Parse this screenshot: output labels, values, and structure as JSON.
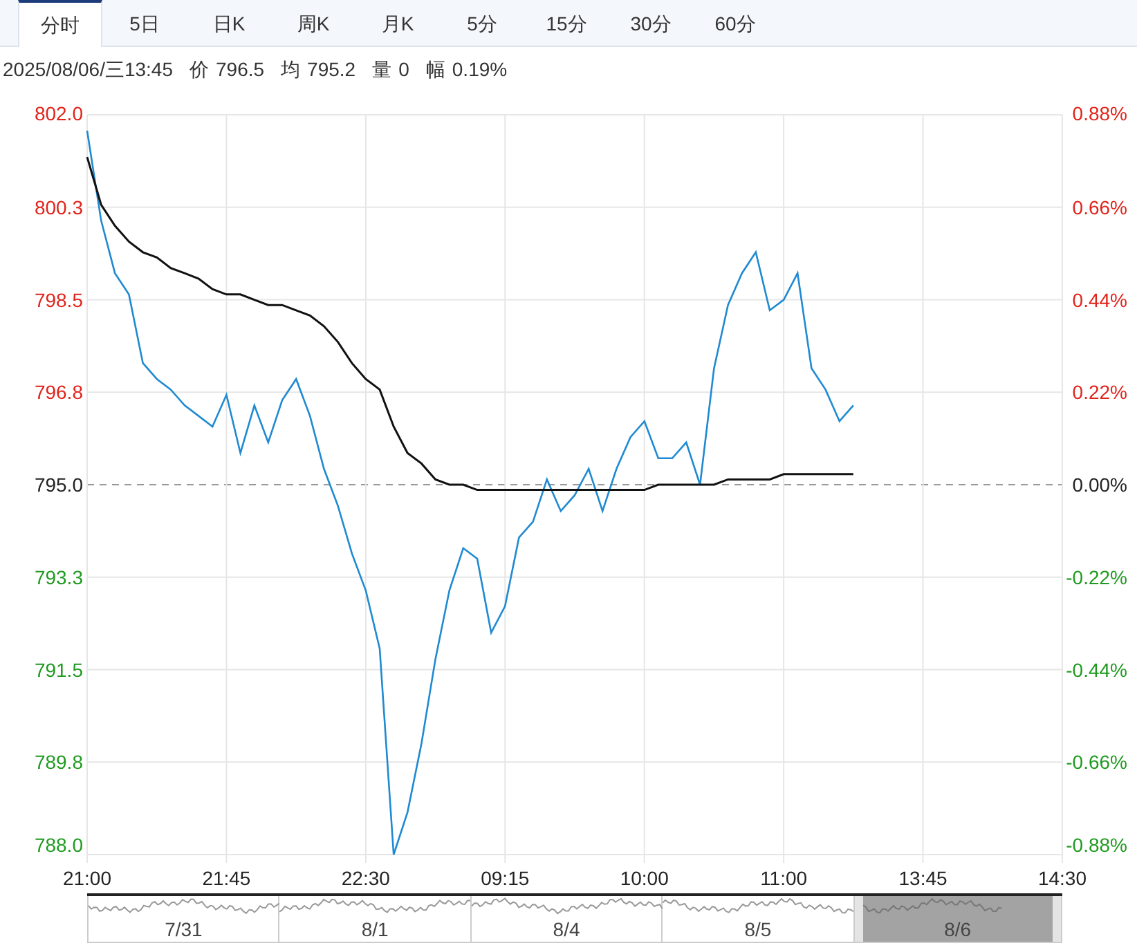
{
  "tabs": [
    {
      "label": "分时",
      "selected": true
    },
    {
      "label": "5日",
      "selected": false
    },
    {
      "label": "日K",
      "selected": false
    },
    {
      "label": "周K",
      "selected": false
    },
    {
      "label": "月K",
      "selected": false
    },
    {
      "label": "5分",
      "selected": false
    },
    {
      "label": "15分",
      "selected": false
    },
    {
      "label": "30分",
      "selected": false
    },
    {
      "label": "60分",
      "selected": false
    }
  ],
  "info": {
    "datetime": "2025/08/06/三13:45",
    "fields": [
      {
        "label": "价",
        "value": "796.5"
      },
      {
        "label": "均",
        "value": "795.2"
      },
      {
        "label": "量",
        "value": "0"
      },
      {
        "label": "幅",
        "value": "0.19%"
      }
    ]
  },
  "chart": {
    "right_axis_labels": [
      "0.88%",
      "0.66%",
      "0.44%",
      "0.22%",
      "0.00%",
      "-0.22%",
      "-0.44%",
      "-0.66%",
      "-0.88%"
    ],
    "chart_data": {
      "type": "line",
      "grid": true,
      "ref_lines": [
        {
          "axis": "y",
          "value": 795.0
        }
      ],
      "categories": [
        "21:00",
        null,
        null,
        null,
        null,
        null,
        null,
        null,
        null,
        null,
        "21:45",
        null,
        null,
        null,
        null,
        null,
        null,
        null,
        null,
        null,
        "22:30",
        null,
        null,
        null,
        null,
        null,
        null,
        null,
        null,
        null,
        "09:15",
        null,
        null,
        null,
        null,
        null,
        null,
        null,
        null,
        null,
        "10:00",
        null,
        null,
        null,
        null,
        null,
        null,
        null,
        null,
        null,
        "11:00",
        null,
        null,
        null,
        null,
        null,
        null,
        null,
        null,
        null,
        "13:45",
        null,
        null,
        null,
        null,
        null,
        null,
        null,
        null,
        null,
        "14:30"
      ],
      "series": [
        {
          "color": "#1f8ad2",
          "values": [
            801.7,
            800.0,
            799.0,
            798.6,
            797.3,
            797.0,
            796.8,
            796.5,
            796.3,
            796.1,
            796.7,
            795.6,
            796.5,
            795.8,
            796.6,
            797.0,
            796.3,
            795.3,
            794.6,
            793.7,
            793.0,
            791.9,
            788.0,
            788.8,
            790.1,
            791.7,
            793.0,
            793.8,
            793.6,
            792.2,
            792.7,
            794.0,
            794.3,
            795.1,
            794.5,
            794.8,
            795.3,
            794.5,
            795.3,
            795.9,
            796.2,
            795.5,
            795.5,
            795.8,
            795.0,
            797.2,
            798.4,
            799.0,
            799.4,
            798.3,
            798.5,
            799.0,
            797.2,
            796.8,
            796.2,
            796.5,
            null,
            null,
            null,
            null,
            null,
            null,
            null,
            null,
            null,
            null,
            null,
            null,
            null,
            null,
            null
          ]
        },
        {
          "color": "#111111",
          "values": [
            801.2,
            800.3,
            799.9,
            799.6,
            799.4,
            799.3,
            799.1,
            799.0,
            798.9,
            798.7,
            798.6,
            798.6,
            798.5,
            798.4,
            798.4,
            798.3,
            798.2,
            798.0,
            797.7,
            797.3,
            797.0,
            796.8,
            796.1,
            795.6,
            795.4,
            795.1,
            795.0,
            795.0,
            794.9,
            794.9,
            794.9,
            794.9,
            794.9,
            794.9,
            794.9,
            794.9,
            794.9,
            794.9,
            794.9,
            794.9,
            794.9,
            795.0,
            795.0,
            795.0,
            795.0,
            795.0,
            795.1,
            795.1,
            795.1,
            795.1,
            795.2,
            795.2,
            795.2,
            795.2,
            795.2,
            795.2,
            null,
            null,
            null,
            null,
            null,
            null,
            null,
            null,
            null,
            null,
            null,
            null,
            null,
            null,
            null
          ]
        }
      ],
      "ylim": [
        788.0,
        802.0
      ],
      "yticks": [
        {
          "value": 802.0,
          "label": "802.0"
        },
        {
          "value": 800.25,
          "label": "800.3"
        },
        {
          "value": 798.5,
          "label": "798.5"
        },
        {
          "value": 796.75,
          "label": "796.8"
        },
        {
          "value": 795.0,
          "label": "795.0"
        },
        {
          "value": 793.25,
          "label": "793.3"
        },
        {
          "value": 791.5,
          "label": "791.5"
        },
        {
          "value": 789.75,
          "label": "789.8"
        },
        {
          "value": 788.0,
          "label": "788.0"
        }
      ]
    }
  },
  "navigator": {
    "segments": [
      {
        "label": "7/31",
        "selected": false
      },
      {
        "label": "8/1",
        "selected": false
      },
      {
        "label": "8/4",
        "selected": false
      },
      {
        "label": "8/5",
        "selected": false
      },
      {
        "label": "8/6",
        "selected": true
      }
    ]
  }
}
